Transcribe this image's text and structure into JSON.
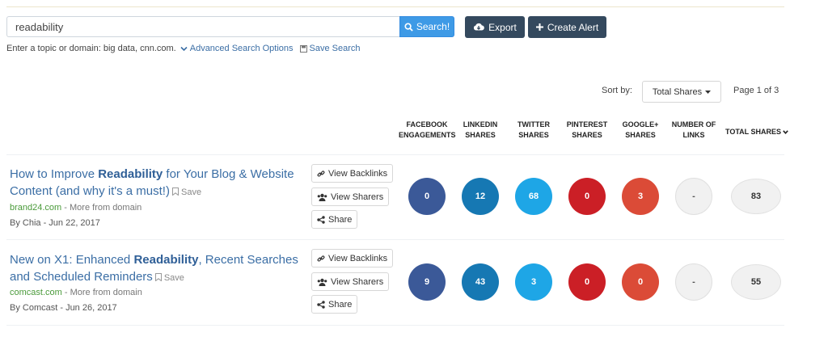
{
  "search": {
    "value": "readability",
    "button_label": "Search!",
    "export_label": "Export",
    "create_alert_label": "Create Alert",
    "hint": "Enter a topic or domain: big data, cnn.com.",
    "advanced_label": "Advanced Search Options",
    "save_search_label": "Save Search"
  },
  "sort": {
    "label": "Sort by:",
    "selected": "Total Shares",
    "page_indicator": "Page 1 of 3"
  },
  "columns": [
    "FACEBOOK\nENGAGEMENTS",
    "LINKEDIN\nSHARES",
    "TWITTER\nSHARES",
    "PINTEREST\nSHARES",
    "GOOGLE+\nSHARES",
    "NUMBER OF\nLINKS",
    "TOTAL SHARES"
  ],
  "colors": {
    "facebook": "#3b5998",
    "linkedin": "#1678b3",
    "twitter": "#1ea6e6",
    "pinterest": "#cb1f26",
    "google": "#db4b37",
    "accent": "#3e9ae6",
    "dark_button": "#34495e"
  },
  "actions": {
    "view_backlinks": "View Backlinks",
    "view_sharers": "View Sharers",
    "share": "Share",
    "save": "Save",
    "more_from_domain": "More from domain"
  },
  "results": [
    {
      "title_before": "How to Improve ",
      "title_highlight": "Readability",
      "title_after": " for Your Blog & Website Content (and why it's a must!)",
      "domain": "brand24.com",
      "byline": "By Chia - Jun 22, 2017",
      "facebook": "0",
      "linkedin": "12",
      "twitter": "68",
      "pinterest": "0",
      "google": "3",
      "links": "-",
      "total": "83"
    },
    {
      "title_before": "New on X1: Enhanced ",
      "title_highlight": "Readability",
      "title_after": ", Recent Searches and Scheduled Reminders",
      "domain": "comcast.com",
      "byline": "By Comcast - Jun 26, 2017",
      "facebook": "9",
      "linkedin": "43",
      "twitter": "3",
      "pinterest": "0",
      "google": "0",
      "links": "-",
      "total": "55"
    }
  ]
}
